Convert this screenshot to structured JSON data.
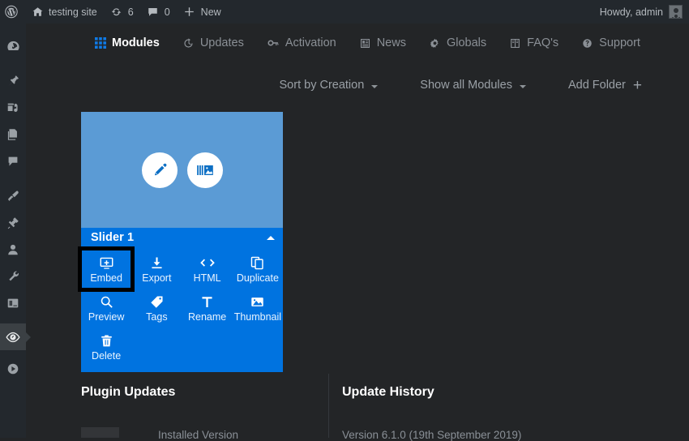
{
  "adminbar": {
    "wp_logo_icon": "wordpress-logo-icon",
    "site": {
      "icon": "home-icon",
      "label": "testing site"
    },
    "updates": {
      "icon": "updates-icon",
      "count": "6"
    },
    "comments": {
      "icon": "comment-icon",
      "count": "0"
    },
    "new": {
      "icon": "plus-icon",
      "label": "New"
    },
    "howdy": "Howdy, admin",
    "avatar_icon": "avatar"
  },
  "sidebar": {
    "items": [
      {
        "name": "dashboard",
        "icon": "dashboard-gauge-icon"
      },
      {
        "name": "posts",
        "icon": "pin-icon"
      },
      {
        "name": "media",
        "icon": "media-icon"
      },
      {
        "name": "pages",
        "icon": "pages-icon"
      },
      {
        "name": "comments",
        "icon": "comment-bubble-icon"
      },
      {
        "name": "appearance",
        "icon": "paintbrush-icon"
      },
      {
        "name": "plugins",
        "icon": "plug-icon"
      },
      {
        "name": "users",
        "icon": "user-icon"
      },
      {
        "name": "tools",
        "icon": "wrench-icon"
      },
      {
        "name": "settings",
        "icon": "sliders-icon"
      },
      {
        "name": "slider-revolution",
        "icon": "eye-slider-icon",
        "active": true
      },
      {
        "name": "media-player",
        "icon": "play-circle-icon"
      }
    ]
  },
  "plugin_nav": {
    "items": [
      {
        "label": "Modules",
        "icon": "grid-icon",
        "active": true
      },
      {
        "label": "Updates",
        "icon": "clock-icon",
        "active": false
      },
      {
        "label": "Activation",
        "icon": "key-icon",
        "active": false
      },
      {
        "label": "News",
        "icon": "newspaper-icon",
        "active": false
      },
      {
        "label": "Globals",
        "icon": "gear-icon",
        "active": false
      },
      {
        "label": "FAQ's",
        "icon": "book-icon",
        "active": false
      },
      {
        "label": "Support",
        "icon": "question-circle-icon",
        "active": false
      }
    ]
  },
  "toolbar": {
    "sort": {
      "label": "Sort by Creation",
      "icon": "chevron-down-icon"
    },
    "filter": {
      "label": "Show all Modules",
      "icon": "chevron-down-icon"
    },
    "add_folder": {
      "label": "Add Folder",
      "icon": "plus-icon"
    }
  },
  "module_card": {
    "title": "Slider 1",
    "collapse_icon": "chevron-up-icon",
    "thumb_buttons": [
      {
        "name": "edit-module",
        "icon": "pencil-icon"
      },
      {
        "name": "slides-module",
        "icon": "slides-icon"
      }
    ],
    "actions": [
      {
        "label": "Embed",
        "icon": "embed-monitor-icon",
        "highlighted": true
      },
      {
        "label": "Export",
        "icon": "download-icon",
        "highlighted": false
      },
      {
        "label": "HTML",
        "icon": "code-brackets-icon",
        "highlighted": false
      },
      {
        "label": "Duplicate",
        "icon": "copy-icon",
        "highlighted": false
      },
      {
        "label": "Preview",
        "icon": "magnifier-icon",
        "highlighted": false
      },
      {
        "label": "Tags",
        "icon": "tag-icon",
        "highlighted": false
      },
      {
        "label": "Rename",
        "icon": "text-t-icon",
        "highlighted": false
      },
      {
        "label": "Thumbnail",
        "icon": "image-icon",
        "highlighted": false
      },
      {
        "label": "Delete",
        "icon": "trash-icon",
        "highlighted": false
      }
    ]
  },
  "lower": {
    "plugin_updates_title": "Plugin Updates",
    "installed_version_label": "Installed Version",
    "update_history_title": "Update History",
    "update_history_entry": "Version 6.1.0 (19th September 2019)"
  },
  "colors": {
    "page_bg": "#232527",
    "adminbar_bg": "#23282d",
    "accent_blue": "#0073e0",
    "thumb_blue": "#5b9bd5",
    "highlight_border": "#000000",
    "muted_text": "#9aa0a6"
  }
}
